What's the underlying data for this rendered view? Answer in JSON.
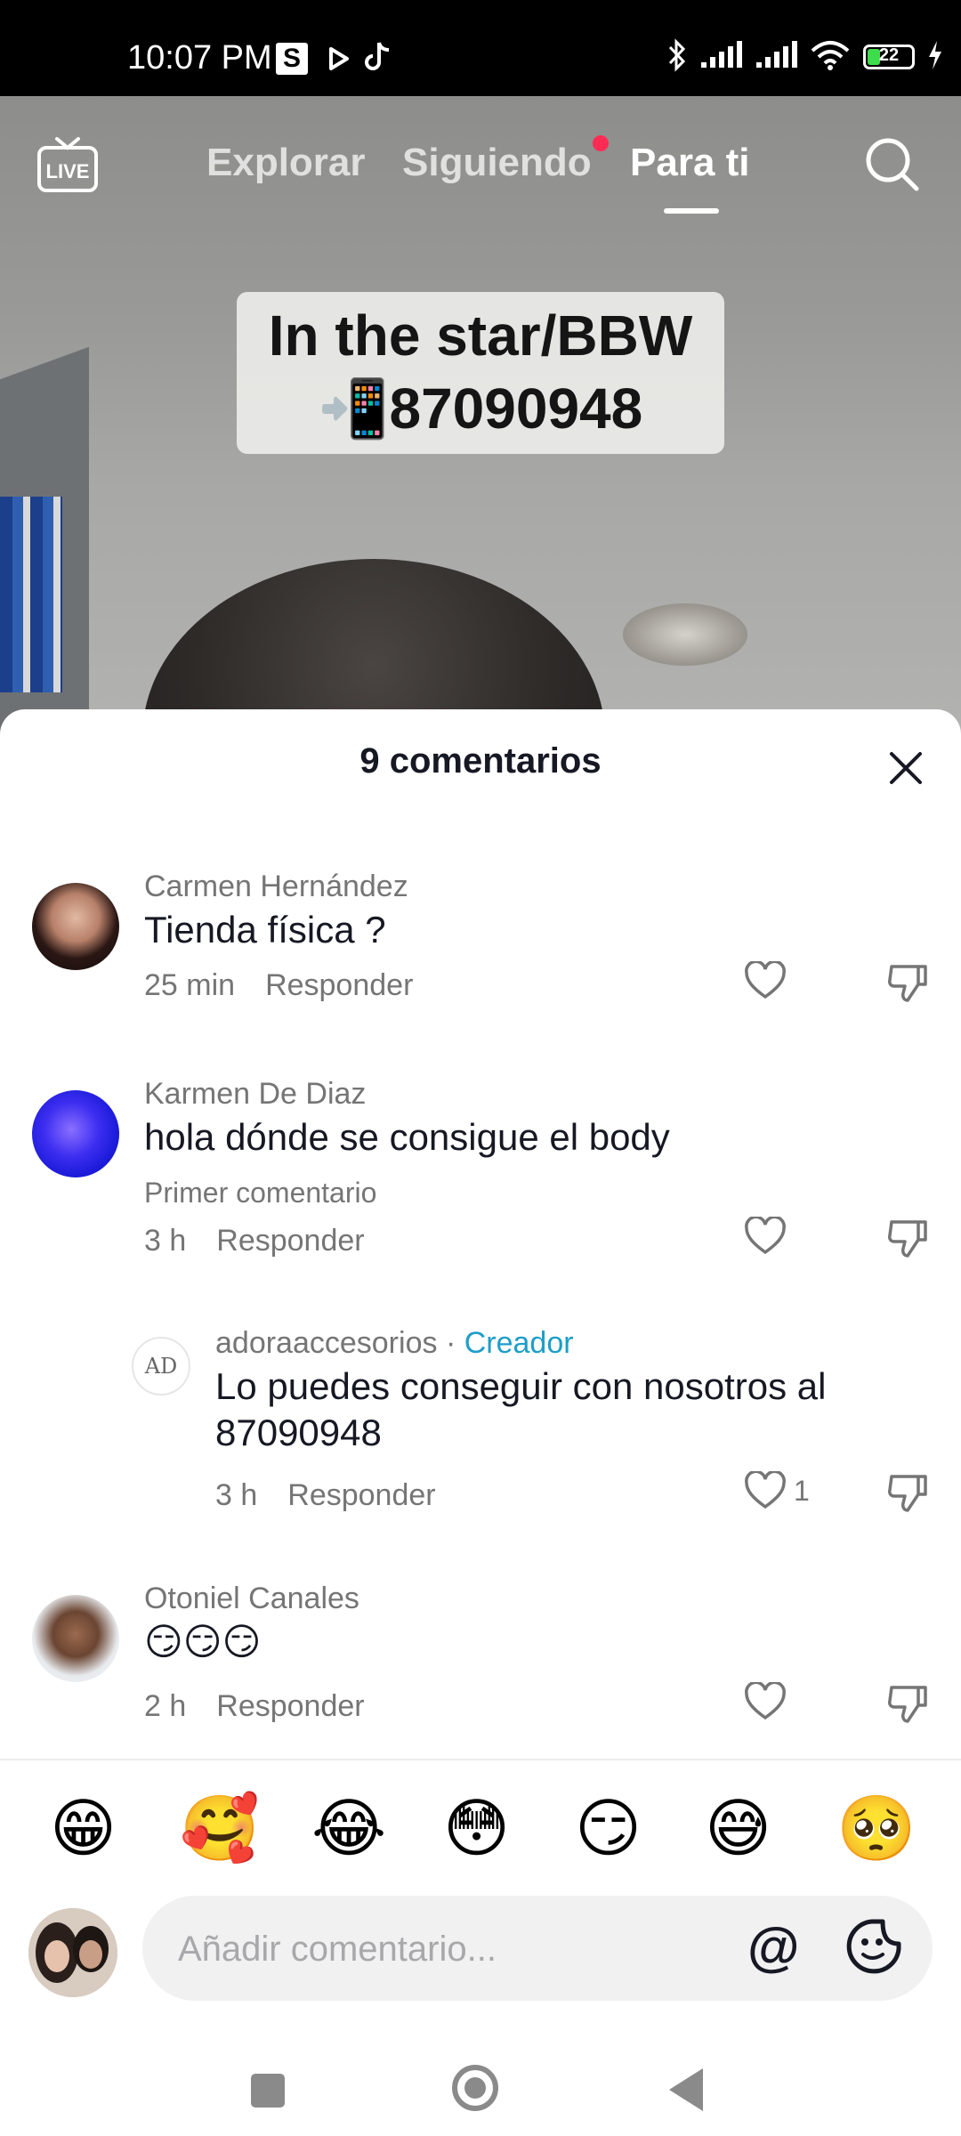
{
  "status_bar": {
    "time": "10:07 PM",
    "s_badge": "S",
    "battery": "22"
  },
  "top_nav": {
    "live_label": "LIVE",
    "tabs": [
      {
        "label": "Explorar"
      },
      {
        "label": "Siguiendo"
      },
      {
        "label": "Para ti"
      }
    ],
    "active_tab": "Para ti"
  },
  "video": {
    "caption_line1": "In the star/BBW",
    "caption_line2": "📲87090948"
  },
  "comments_sheet": {
    "title": "9 comentarios",
    "reply_label": "Responder",
    "comments": [
      {
        "user": "Carmen Hernández",
        "text": "Tienda física ?",
        "time": "25 min"
      },
      {
        "user": "Karmen De Diaz",
        "text": "hola dónde se consigue el body",
        "note": "Primer comentario",
        "time": "3 h"
      },
      {
        "user": "adoraaccesorios",
        "separator": "·",
        "badge": "Creador",
        "avatar_text": "AD",
        "text": "Lo puedes conseguir con nosotros al 87090948",
        "time": "3 h",
        "likes": "1"
      },
      {
        "user": "Otoniel Canales",
        "text": "😏😏😏",
        "time": "2 h"
      }
    ]
  },
  "emoji_bar": [
    "😁",
    "🥰",
    "😂",
    "😳",
    "😏",
    "😅",
    "🥺"
  ],
  "input": {
    "placeholder": "Añadir comentario...",
    "at_symbol": "@"
  },
  "colors": {
    "accent_red": "#fe2c55",
    "creator_blue": "#1e9ec8",
    "text_primary": "#161823",
    "text_secondary": "#757575"
  }
}
